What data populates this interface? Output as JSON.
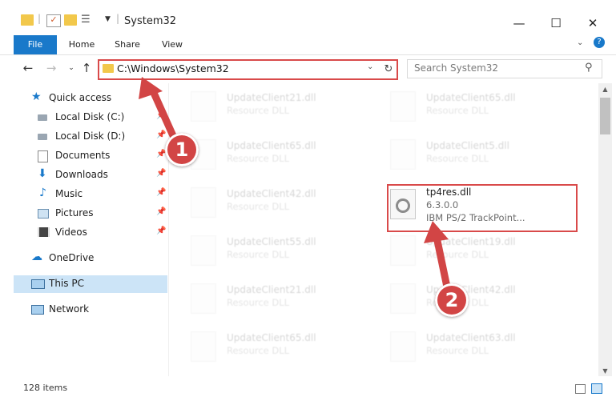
{
  "window": {
    "title": "System32"
  },
  "ribbon": {
    "tabs": [
      {
        "label": "File"
      },
      {
        "label": "Home"
      },
      {
        "label": "Share"
      },
      {
        "label": "View"
      }
    ]
  },
  "address": {
    "path": "C:\\Windows\\System32"
  },
  "search": {
    "placeholder": "Search System32"
  },
  "sidebar": {
    "items": [
      {
        "label": "Quick access"
      },
      {
        "label": "Local Disk (C:)"
      },
      {
        "label": "Local Disk (D:)"
      },
      {
        "label": "Documents"
      },
      {
        "label": "Downloads"
      },
      {
        "label": "Music"
      },
      {
        "label": "Pictures"
      },
      {
        "label": "Videos"
      },
      {
        "label": "OneDrive"
      },
      {
        "label": "This PC"
      },
      {
        "label": "Network"
      }
    ]
  },
  "files": [
    {
      "name": "UpdateClient21.dll",
      "desc": "Resource DLL"
    },
    {
      "name": "UpdateClient65.dll",
      "desc": "Resource DLL"
    },
    {
      "name": "UpdateClient65.dll",
      "desc": "Resource DLL"
    },
    {
      "name": "UpdateClient5.dll",
      "desc": "Resource DLL"
    },
    {
      "name": "UpdateClient42.dll",
      "desc": "Resource DLL"
    },
    {
      "name": "tp4res.dll",
      "version": "6.3.0.0",
      "desc": "IBM PS/2 TrackPoint..."
    },
    {
      "name": "UpdateClient55.dll",
      "desc": "Resource DLL"
    },
    {
      "name": "UpdateClient19.dll",
      "desc": "Resource DLL"
    },
    {
      "name": "UpdateClient21.dll",
      "desc": "Resource DLL"
    },
    {
      "name": "UpdateClient42.dll",
      "desc": "Resource DLL"
    },
    {
      "name": "UpdateClient65.dll",
      "desc": "Resource DLL"
    },
    {
      "name": "UpdateClient63.dll",
      "desc": "Resource DLL"
    }
  ],
  "status": {
    "item_count": "128 items"
  },
  "annotations": {
    "step1": "1",
    "step2": "2",
    "color": "#d24545"
  },
  "window_controls": {
    "minimize": "—",
    "maximize": "☐",
    "close": "✕",
    "help": "?"
  }
}
